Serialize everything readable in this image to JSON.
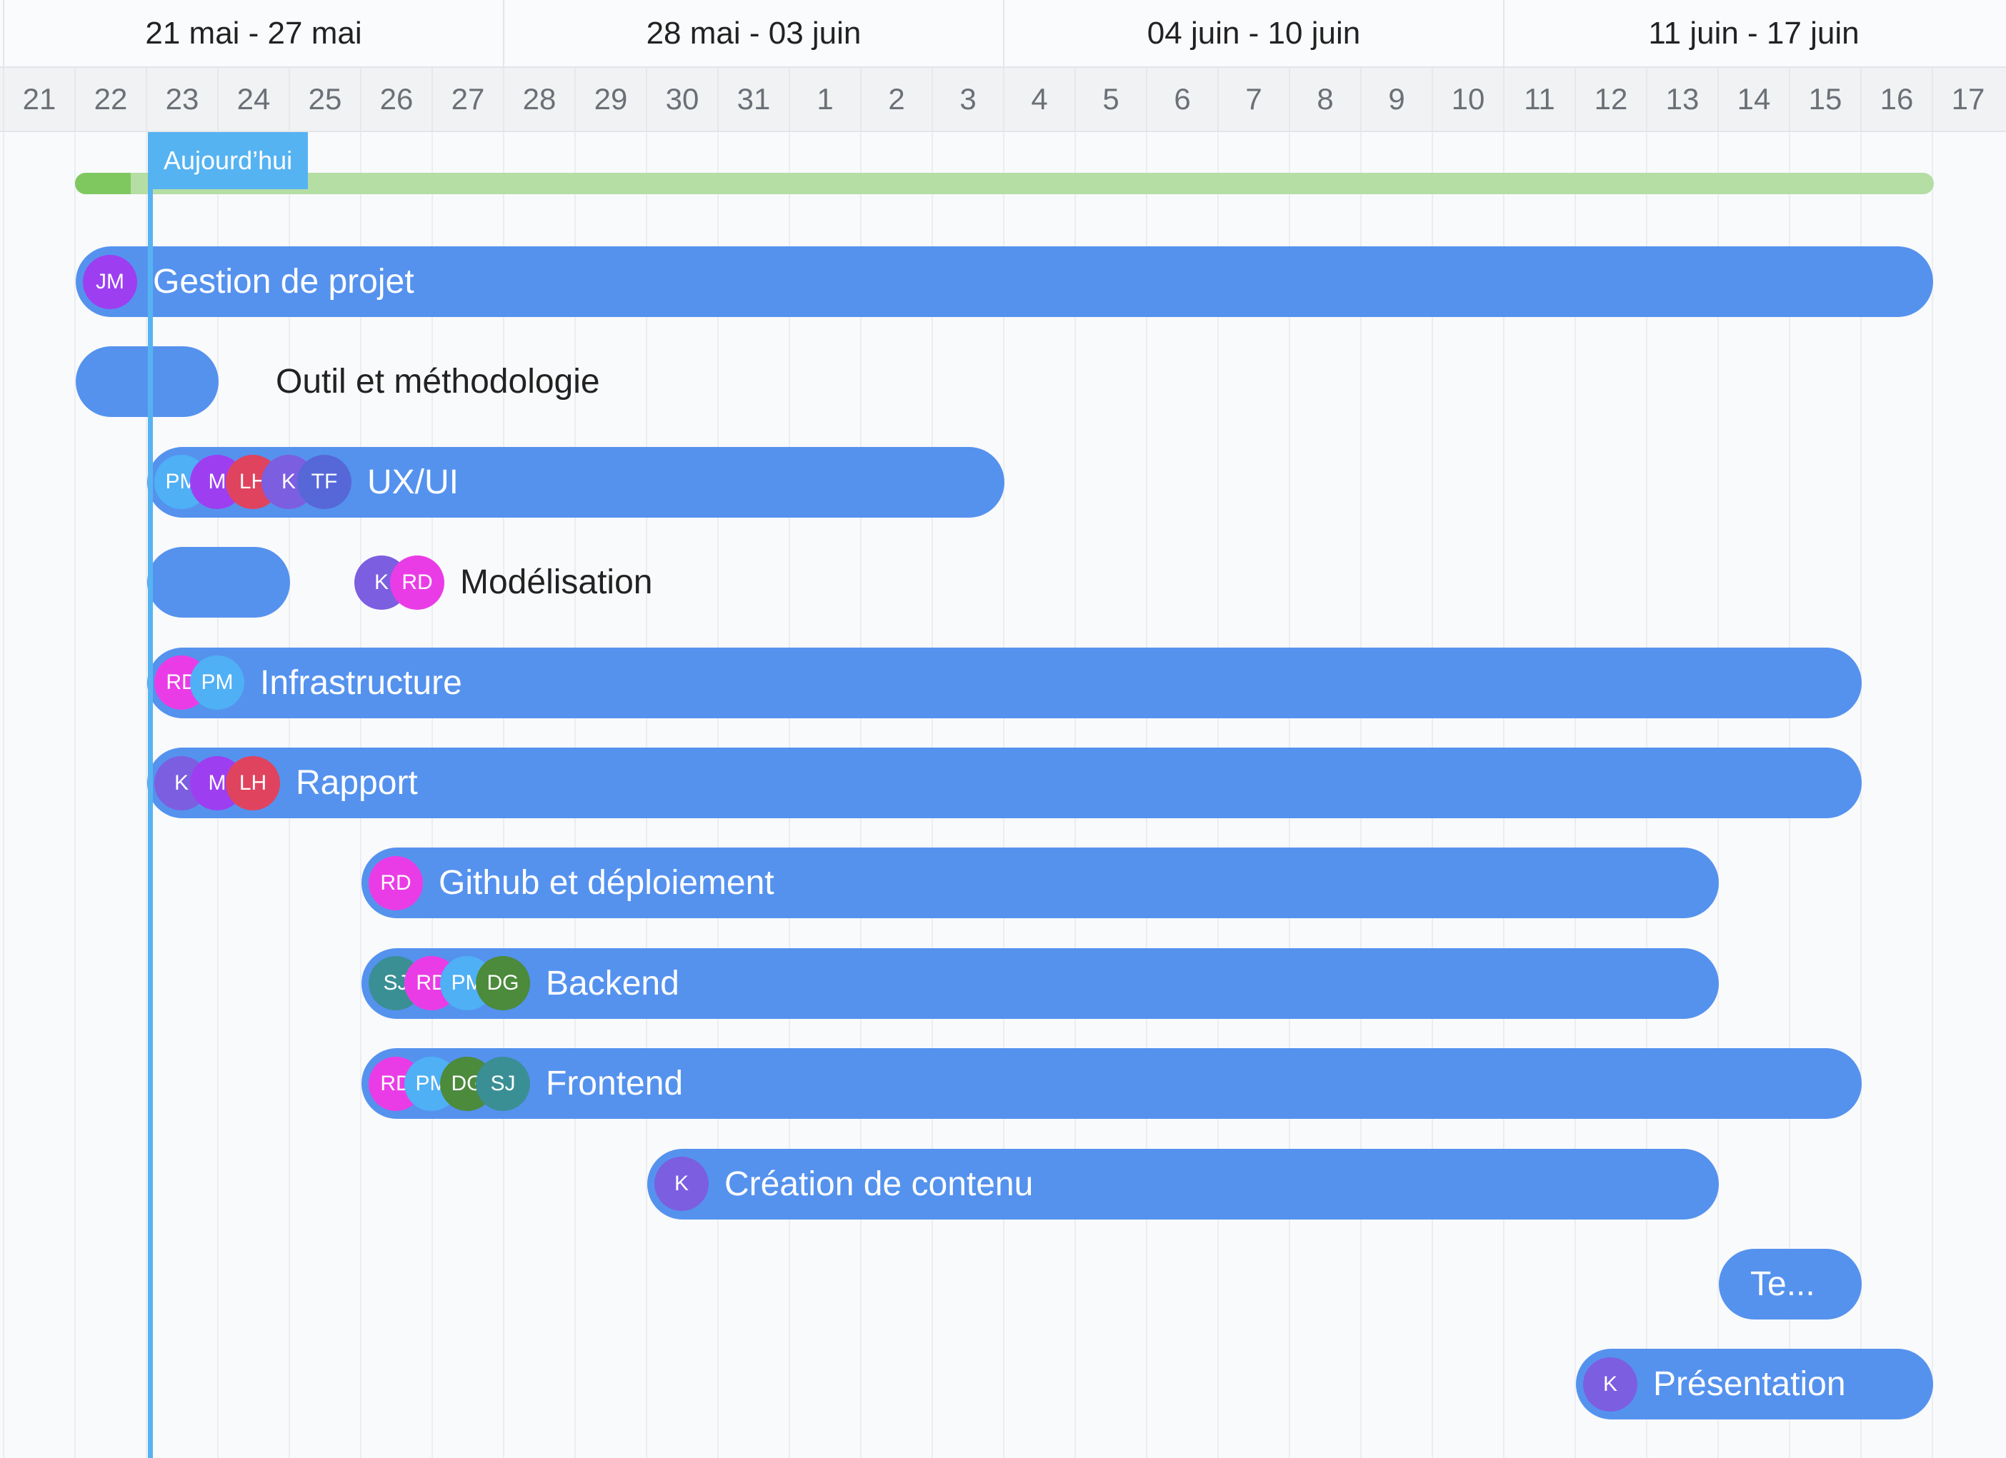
{
  "weeks": [
    "21 mai - 27 mai",
    "28 mai - 03 juin",
    "04 juin - 10 juin",
    "11 juin - 17 juin"
  ],
  "days": [
    "21",
    "22",
    "23",
    "24",
    "25",
    "26",
    "27",
    "28",
    "29",
    "30",
    "31",
    "1",
    "2",
    "3",
    "4",
    "5",
    "6",
    "7",
    "8",
    "9",
    "10",
    "11",
    "12",
    "13",
    "14",
    "15",
    "16",
    "17"
  ],
  "today_label": "Aujourd’hui",
  "overall_progress_fraction": 0.03,
  "colors": {
    "task_bar": "#5592ee",
    "today": "#56b3f2",
    "progress_track": "#b4dea3",
    "progress_fill": "#7fc85f"
  },
  "avatar_colors": {
    "JM": "#9d3ff0",
    "PM": "#4fb0f5",
    "M": "#9d3ff0",
    "LH": "#e0435e",
    "K": "#7c5ee0",
    "TF": "#5668d8",
    "RD": "#ea3ce6",
    "SJ": "#3a8f95",
    "DG": "#4c8a3c"
  },
  "tasks": [
    {
      "name": "Gestion de projet",
      "start": 1,
      "end": 27,
      "assignees": [
        "JM"
      ]
    },
    {
      "name": "Outil et méthodologie",
      "start": 1,
      "end": 3,
      "assignees": [],
      "label_outside": true
    },
    {
      "name": "UX/UI",
      "start": 2,
      "end": 14,
      "assignees": [
        "PM",
        "M",
        "LH",
        "K",
        "TF"
      ]
    },
    {
      "name": "Modélisation",
      "start": 2,
      "end": 4,
      "assignees": [
        "K",
        "RD"
      ],
      "label_outside": true
    },
    {
      "name": "Infrastructure",
      "start": 2,
      "end": 26,
      "assignees": [
        "RD",
        "PM"
      ]
    },
    {
      "name": "Rapport",
      "start": 2,
      "end": 26,
      "assignees": [
        "K",
        "M",
        "LH"
      ]
    },
    {
      "name": "Github et déploiement",
      "start": 5,
      "end": 24,
      "assignees": [
        "RD"
      ]
    },
    {
      "name": "Backend",
      "start": 5,
      "end": 24,
      "assignees": [
        "SJ",
        "RD",
        "PM",
        "DG"
      ]
    },
    {
      "name": "Frontend",
      "start": 5,
      "end": 26,
      "assignees": [
        "RD",
        "PM",
        "DG",
        "SJ"
      ]
    },
    {
      "name": "Création de contenu",
      "start": 9,
      "end": 24,
      "assignees": [
        "K"
      ]
    },
    {
      "name": "Te...",
      "start": 24,
      "end": 26,
      "assignees": []
    },
    {
      "name": "Présentation",
      "start": 22,
      "end": 27,
      "assignees": [
        "K"
      ]
    }
  ]
}
